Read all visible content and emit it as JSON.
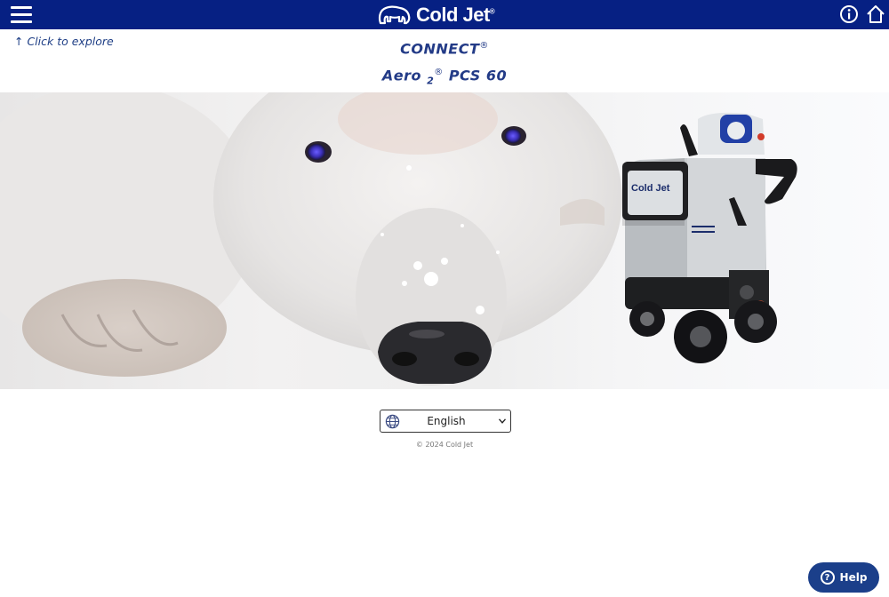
{
  "header": {
    "brand": "Cold Jet",
    "trademark": "®",
    "menu_icon": "hamburger-menu-icon",
    "info_icon": "info-icon",
    "home_icon": "home-icon",
    "background_color": "#062083"
  },
  "explore_link": "↑ Click to explore",
  "title": {
    "line1": "CONNECT",
    "line1_mark": "®",
    "line2_name": "Aero",
    "line2_sub": "2",
    "line2_mark": "®",
    "line2_model": "PCS 60"
  },
  "hero": {
    "description_subject": "polar bear",
    "machine_brand": "Cold Jet"
  },
  "language": {
    "selected": "English",
    "icon": "globe-icon"
  },
  "footer": {
    "copyright": "© 2024 Cold Jet"
  },
  "help": {
    "icon": "question-circle-icon",
    "label": "Help"
  },
  "colors": {
    "brand_blue": "#062083",
    "title_blue": "#233b87",
    "help_blue": "#1b3f8a"
  }
}
